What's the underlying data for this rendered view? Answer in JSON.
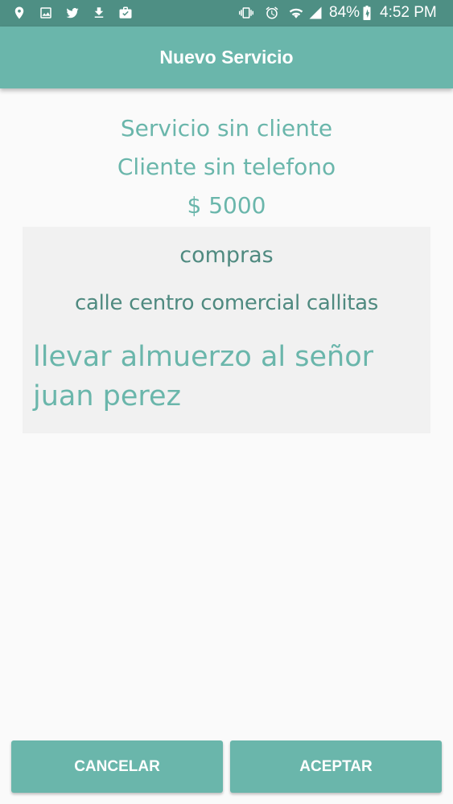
{
  "status_bar": {
    "battery": "84%",
    "time": "4:52 PM",
    "icons": [
      "location-icon",
      "image-icon",
      "twitter-icon",
      "download-icon",
      "briefcase-icon",
      "vibrate-icon",
      "alarm-icon",
      "wifi-icon",
      "signal-icon",
      "battery-icon"
    ]
  },
  "app_bar": {
    "title": "Nuevo Servicio"
  },
  "summary": {
    "service": "Servicio sin cliente",
    "phone": "Cliente sin telefono",
    "price": "$ 5000"
  },
  "detail": {
    "category": "compras",
    "address": "calle centro comercial callitas",
    "description": "llevar almuerzo al señor juan perez"
  },
  "actions": {
    "cancel_label": "CANCELAR",
    "accept_label": "ACEPTAR"
  },
  "colors": {
    "status_bar": "#4e8f84",
    "accent": "#6ab6ab",
    "dark_text": "#4f8a80",
    "card_bg": "#f1f1f1"
  }
}
